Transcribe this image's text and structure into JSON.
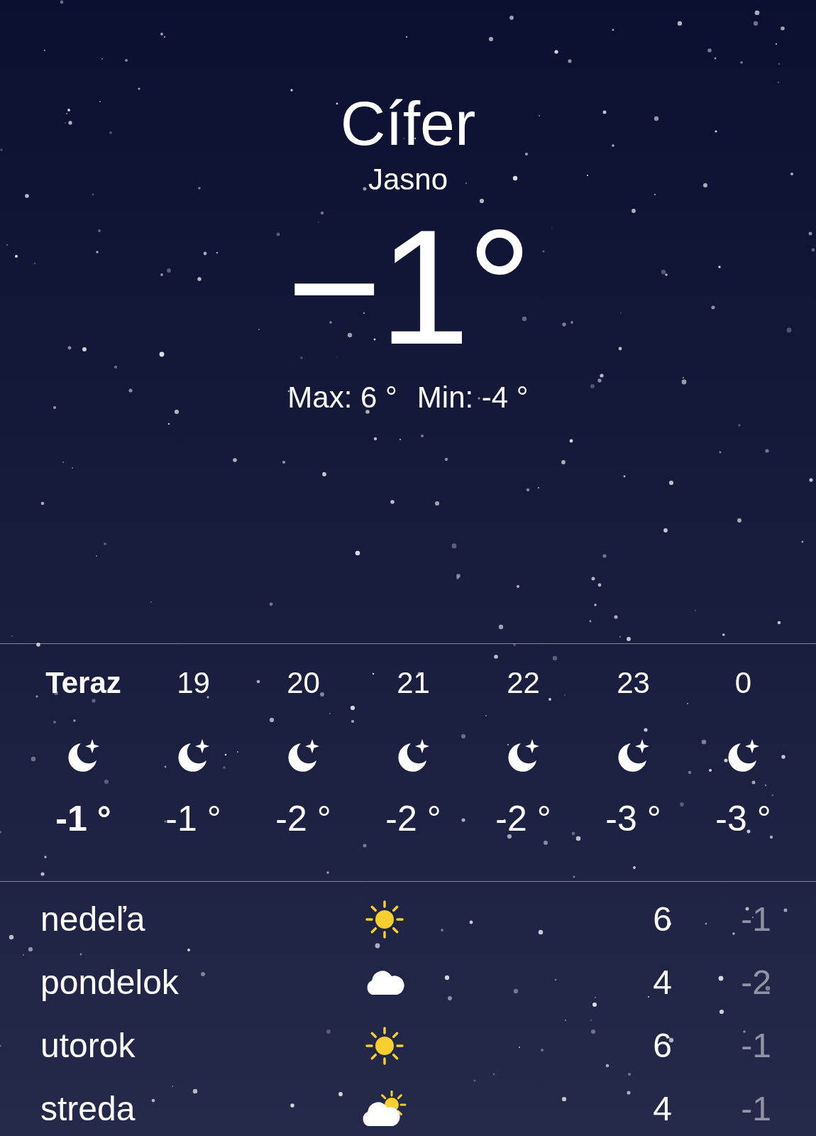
{
  "location": {
    "city": "Cífer",
    "condition": "Jasno",
    "temperature": "−1°",
    "high": "Max: 6 °",
    "low": "Min: -4 °"
  },
  "hourly": [
    {
      "time": "Teraz",
      "kind": "moon-star",
      "temperature": "-1 °",
      "current": true
    },
    {
      "time": "19",
      "kind": "moon-star",
      "temperature": "-1 °",
      "current": false
    },
    {
      "time": "20",
      "kind": "moon-star",
      "temperature": "-2 °",
      "current": false
    },
    {
      "time": "21",
      "kind": "moon-star",
      "temperature": "-2 °",
      "current": false
    },
    {
      "time": "22",
      "kind": "moon-star",
      "temperature": "-2 °",
      "current": false
    },
    {
      "time": "23",
      "kind": "moon-star",
      "temperature": "-3 °",
      "current": false
    },
    {
      "time": "0",
      "kind": "moon-star",
      "temperature": "-3 °",
      "current": false
    }
  ],
  "daily": [
    {
      "day": "nedeľa",
      "kind": "sun",
      "high": "6",
      "low": "-1"
    },
    {
      "day": "pondelok",
      "kind": "cloud",
      "high": "4",
      "low": "-2"
    },
    {
      "day": "utorok",
      "kind": "sun",
      "high": "6",
      "low": "-1"
    },
    {
      "day": "streda",
      "kind": "sun-cloud",
      "high": "4",
      "low": "-1"
    }
  ]
}
